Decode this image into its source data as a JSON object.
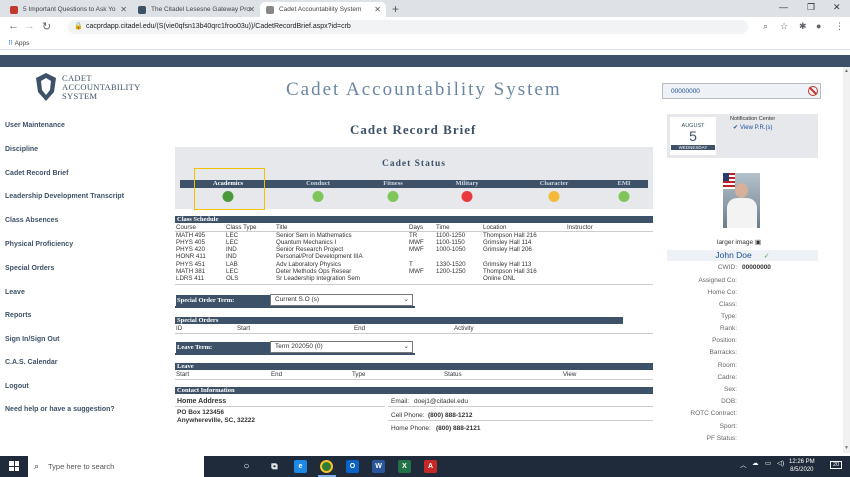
{
  "browser": {
    "tabs": [
      {
        "title": "5 Important Questions to Ask Yo",
        "fav_color": "#c0392b"
      },
      {
        "title": "The Citadel Lesesne Gateway Pro",
        "fav_color": "#3d5168"
      },
      {
        "title": "Cadet Accountability System",
        "fav_color": "#888888"
      }
    ],
    "url": "cacprdapp.citadel.edu/(S(vie0qfsn13b40qrc1froo03u))/CadetRecordBrief.aspx?id=crb",
    "bookmarks_label": "Apps"
  },
  "header": {
    "logo_text_1": "CADET",
    "logo_text_2": "ACCOUNTABILITY",
    "logo_text_3": "SYSTEM",
    "app_title": "Cadet Accountability System",
    "cwid_box": "00000000"
  },
  "sidebar": {
    "items": [
      {
        "label": "User Maintenance"
      },
      {
        "label": "Discipline"
      },
      {
        "label": "Cadet Record Brief"
      },
      {
        "label": "Leadership Development Transcript"
      },
      {
        "label": "Class Absences"
      },
      {
        "label": "Physical Proficiency"
      },
      {
        "label": "Special Orders"
      },
      {
        "label": "Leave"
      },
      {
        "label": "Reports"
      },
      {
        "label": "Sign In/Sign Out"
      },
      {
        "label": "C.A.S. Calendar"
      },
      {
        "label": "Logout"
      },
      {
        "label": "Need help or have a suggestion?"
      }
    ]
  },
  "main": {
    "title": "Cadet Record Brief",
    "status": {
      "title": "Cadet Status",
      "items": [
        {
          "label": "Academics",
          "color": "#4a9a3a"
        },
        {
          "label": "Conduct",
          "color": "#7ec65a"
        },
        {
          "label": "Fitness",
          "color": "#7ec65a"
        },
        {
          "label": "Military",
          "color": "#e8393d"
        },
        {
          "label": "Character",
          "color": "#f5b93a"
        },
        {
          "label": "EMI",
          "color": "#7ec65a"
        }
      ]
    },
    "schedule": {
      "title": "Class Schedule",
      "headers": [
        "Course",
        "Class Type",
        "Title",
        "Days",
        "Time",
        "Location",
        "Instructor"
      ],
      "rows": [
        [
          "MATH 495",
          "LEC",
          "Senior Sem in Mathematics",
          "TR",
          "1100-1250",
          "Thompson Hall 216",
          ""
        ],
        [
          "PHYS 405",
          "LEC",
          "Quantum Mechanics I",
          "MWF",
          "1100-1150",
          "Grimsley Hall 114",
          ""
        ],
        [
          "PHYS 420",
          "IND",
          "Senior Research Project",
          "MWF",
          "1000-1050",
          "Grimsley Hall 206",
          ""
        ],
        [
          "HONR 411",
          "IND",
          "Personal/Prof Development IIIA",
          "",
          "",
          "",
          ""
        ],
        [
          "PHYS 451",
          "LAB",
          "Adv Laboratory Physics",
          "T",
          "1330-1520",
          "Grimsley Hall 113",
          ""
        ],
        [
          "MATH 381",
          "LEC",
          "Deter Methods Ops Resear",
          "MWF",
          "1200-1250",
          "Thompson Hall 316",
          ""
        ],
        [
          "LDRS 411",
          "OLS",
          "Sr Leadership Integration Sem",
          "",
          "",
          "Online ONL",
          ""
        ]
      ]
    },
    "special_order_term": {
      "label": "Special Order Term:",
      "value": "Current S.O (s)"
    },
    "special_orders": {
      "title": "Special Orders",
      "headers": [
        "ID",
        "Start",
        "End",
        "Activity"
      ]
    },
    "leave_term": {
      "label": "Leave Term:",
      "value": "Term 202050 (0)"
    },
    "leave": {
      "title": "Leave",
      "headers": [
        "Start",
        "End",
        "Type",
        "Status",
        "View"
      ]
    },
    "contact": {
      "title": "Contact Information",
      "home_address_label": "Home Address",
      "address_line1": "PO Box 123456",
      "address_line2": "Anywhereville, SC, 32222",
      "email_label": "Email:",
      "email": "doej1@citadel.edu",
      "cell_label": "Cell Phone:",
      "cell": "(800) 888-1212",
      "home_label": "Home Phone:",
      "home": "(800) 888-2121"
    }
  },
  "profile": {
    "notification_title": "Notification Center",
    "notification_item": "View P.R.(s)",
    "date_month": "AUGUST",
    "date_day": "5",
    "date_weekday": "WEDNESDAY",
    "large_image_label": "larger image",
    "name": "John Doe",
    "fields": [
      {
        "label": "CWID:",
        "value": "00000000"
      },
      {
        "label": "Assigned Co:",
        "value": ""
      },
      {
        "label": "Home Co:",
        "value": ""
      },
      {
        "label": "Class:",
        "value": ""
      },
      {
        "label": "Type:",
        "value": ""
      },
      {
        "label": "Rank:",
        "value": ""
      },
      {
        "label": "Position:",
        "value": ""
      },
      {
        "label": "Barracks:",
        "value": ""
      },
      {
        "label": "Room:",
        "value": ""
      },
      {
        "label": "Cadre:",
        "value": ""
      },
      {
        "label": "Sex:",
        "value": ""
      },
      {
        "label": "DOB:",
        "value": ""
      },
      {
        "label": "ROTC Contract:",
        "value": ""
      },
      {
        "label": "Sport:",
        "value": ""
      },
      {
        "label": "PF Status:",
        "value": ""
      }
    ]
  },
  "taskbar": {
    "search_placeholder": "Type here to search",
    "time": "12:26 PM",
    "date": "8/5/2020",
    "notif_count": "20"
  }
}
